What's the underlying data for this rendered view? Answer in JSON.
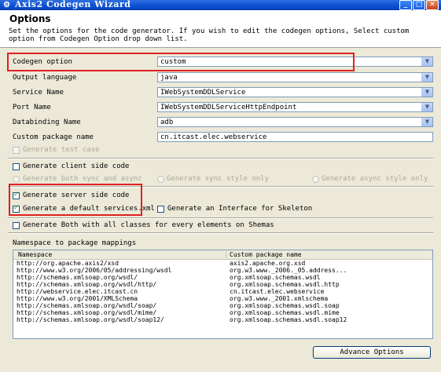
{
  "window": {
    "title": "Axis2 Codegen Wizard",
    "controls": {
      "minimize": "_",
      "maximize": "□",
      "close": "✕"
    }
  },
  "header": {
    "title": "Options",
    "description": "Set the options for the code generator. If you wish to edit the codegen options, Select custom option from Codegen Option drop down list."
  },
  "form": {
    "codegen_option": {
      "label": "Codegen option",
      "value": "custom"
    },
    "output_language": {
      "label": "Output language",
      "value": "java"
    },
    "service_name": {
      "label": "Service Name",
      "value": "IWebSystemDDLService"
    },
    "port_name": {
      "label": "Port Name",
      "value": "IWebSystemDDLServiceHttpEndpoint"
    },
    "databinding_name": {
      "label": "Databinding Name",
      "value": "adb"
    },
    "custom_package_name": {
      "label": "Custom package name",
      "value": "cn.itcast.elec.webservice"
    }
  },
  "options": {
    "generate_test_case": {
      "label": "Generate test case",
      "checked": false,
      "enabled": false
    },
    "generate_client_side": {
      "label": "Generate client side code",
      "checked": false,
      "enabled": true
    },
    "both_sync_async": {
      "label": "Generate both sync and async"
    },
    "sync_only": {
      "label": "Generate sync style only"
    },
    "async_only": {
      "label": "Generate async style only"
    },
    "generate_server_side": {
      "label": "Generate server side code",
      "checked": true,
      "enabled": true
    },
    "generate_services_xml": {
      "label": "Generate a default services.xml",
      "checked": true,
      "enabled": true
    },
    "generate_interface_skeleton": {
      "label": "Generate an Interface for Skeleton",
      "checked": false,
      "enabled": true
    },
    "generate_all_classes": {
      "label": "Generate Both with all classes for every elements on Shemas",
      "checked": false,
      "enabled": true
    }
  },
  "namespace_table": {
    "section_label": "Namespace to package mappings",
    "columns": [
      "Namespace",
      "Custom package name"
    ],
    "rows": [
      [
        "http://org.apache.axis2/xsd",
        "axis2.apache.org.xsd"
      ],
      [
        "http://www.w3.org/2006/05/addressing/wsdl",
        "org.w3.www._2006._05.address..."
      ],
      [
        "http://schemas.xmlsoap.org/wsdl/",
        "org.xmlsoap.schemas.wsdl"
      ],
      [
        "http://schemas.xmlsoap.org/wsdl/http/",
        "org.xmlsoap.schemas.wsdl.http"
      ],
      [
        "http://webservice.elec.itcast.cn",
        "cn.itcast.elec.webservice"
      ],
      [
        "http://www.w3.org/2001/XMLSchema",
        "org.w3.www._2001.xmlschema"
      ],
      [
        "http://schemas.xmlsoap.org/wsdl/soap/",
        "org.xmlsoap.schemas.wsdl.soap"
      ],
      [
        "http://schemas.xmlsoap.org/wsdl/mime/",
        "org.xmlsoap.schemas.wsdl.mime"
      ],
      [
        "http://schemas.xmlsoap.org/wsdl/soap12/",
        "org.xmlsoap.schemas.wsdl.soap12"
      ]
    ]
  },
  "buttons": {
    "advance_options": "Advance Options"
  },
  "colors": {
    "titlebar": "#0a4fd1",
    "highlight_box": "#e02020",
    "dialog_bg": "#ece9d8"
  }
}
